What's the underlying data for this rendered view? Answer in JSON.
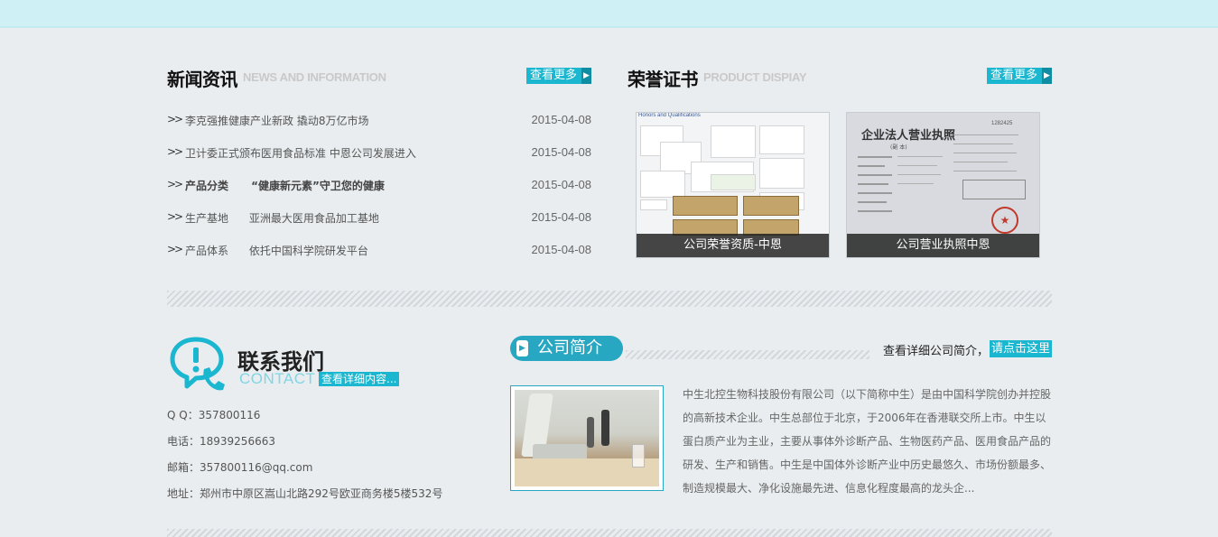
{
  "news": {
    "title": "新闻资讯",
    "subtitle": "NEWS AND INFORMATION",
    "more_label": "查看更多",
    "items": [
      {
        "title": "李克强推健康产业新政 撬动8万亿市场",
        "date": "2015-04-08",
        "bold": false
      },
      {
        "title": "卫计委正式颁布医用食品标准 中恩公司发展进入",
        "date": "2015-04-08",
        "bold": false
      },
      {
        "title": "产品分类      “健康新元素”守卫您的健康",
        "date": "2015-04-08",
        "bold": true
      },
      {
        "title": "生产基地      亚洲最大医用食品加工基地",
        "date": "2015-04-08",
        "bold": false
      },
      {
        "title": "产品体系      依托中国科学院研发平台",
        "date": "2015-04-08",
        "bold": false
      }
    ]
  },
  "honor": {
    "title": "荣誉证书",
    "subtitle": "PRODUCT DISPIAY",
    "more_label": "查看更多",
    "certs": [
      {
        "caption": "公司荣誉资质-中恩",
        "header_text": "Honors and Qualifications"
      },
      {
        "caption": "公司营业执照中恩",
        "header_text": "企业法人营业执照",
        "sub_text": "(副 本)",
        "serial": "1282425"
      }
    ]
  },
  "contact": {
    "title": "联系我们",
    "subtitle": "CONTACT",
    "more_label": "查看详细内容...",
    "lines": [
      "Q Q：357800116",
      "电话：18939256663",
      "邮箱：357800116@qq.com",
      "地址：郑州市中原区嵩山北路292号欧亚商务楼5楼532号"
    ]
  },
  "intro": {
    "title": "公司简介",
    "link_prefix": "查看详细公司简介，",
    "link_label": "请点击这里",
    "text": "中生北控生物科技股份有限公司（以下简称中生）是由中国科学院创办并控股的高新技术企业。中生总部位于北京，于2006年在香港联交所上市。中生以蛋白质产业为主业，主要从事体外诊断产品、生物医药产品、医用食品产品的研发、生产和销售。中生是中国体外诊断产业中历史最悠久、市场份额最多、制造规模最大、净化设施最先进、信息化程度最高的龙头企..."
  },
  "colors": {
    "accent": "#1bb6cf",
    "accent_dark": "#27a7c1",
    "top_bar": "#cff0f5",
    "background": "#e9edf0"
  }
}
